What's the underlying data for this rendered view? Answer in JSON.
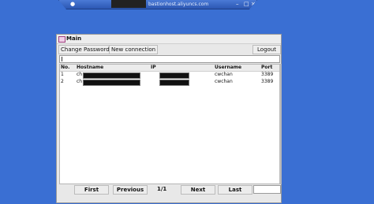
{
  "remote_bar": {
    "host": "bastionhost.aliyuncs.com"
  },
  "window": {
    "title": "Main"
  },
  "toolbar": {
    "change_password": "Change Password",
    "new_connection": "New connection",
    "logout": "Logout"
  },
  "table": {
    "headers": [
      "No.",
      "Hostname",
      "IP",
      "Username",
      "Port"
    ],
    "rows": [
      {
        "no": "1",
        "hostname": "ch",
        "username": "cwchan",
        "port": "3389"
      },
      {
        "no": "2",
        "hostname": "ch",
        "username": "cwchan",
        "port": "3389"
      }
    ]
  },
  "pager": {
    "first": "First",
    "previous": "Previous",
    "page": "1/1",
    "next": "Next",
    "last": "Last"
  },
  "colors": {
    "desktop": "#3a6fd3",
    "window_bg": "#e8e8e8"
  }
}
